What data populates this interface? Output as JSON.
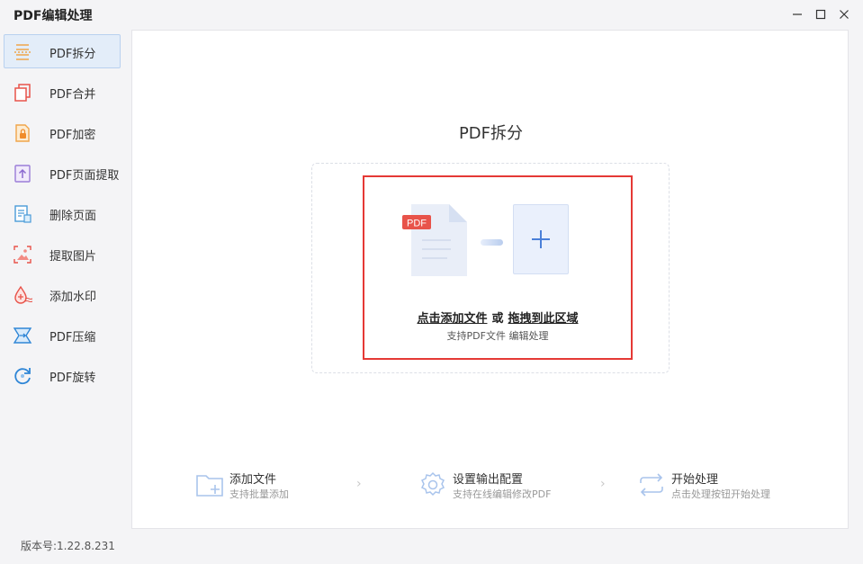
{
  "app": {
    "title": "PDF编辑处理",
    "version": "版本号:1.22.8.231"
  },
  "window_controls": {
    "minimize": "—",
    "maximize": "☐",
    "close": "✕"
  },
  "sidebar": {
    "items": [
      {
        "label": "PDF拆分",
        "icon": "split-icon",
        "active": true
      },
      {
        "label": "PDF合并",
        "icon": "merge-icon"
      },
      {
        "label": "PDF加密",
        "icon": "lock-file-icon"
      },
      {
        "label": "PDF页面提取",
        "icon": "page-extract-icon"
      },
      {
        "label": "删除页面",
        "icon": "delete-page-icon"
      },
      {
        "label": "提取图片",
        "icon": "image-extract-icon"
      },
      {
        "label": "添加水印",
        "icon": "watermark-icon"
      },
      {
        "label": "PDF压缩",
        "icon": "compress-icon"
      },
      {
        "label": "PDF旋转",
        "icon": "rotate-icon"
      }
    ]
  },
  "main": {
    "title": "PDF拆分",
    "dropzone": {
      "badge": "PDF",
      "add_link": "点击添加文件",
      "or": "或",
      "drag_link": "拖拽到此区域",
      "subtitle": "支持PDF文件 编辑处理"
    },
    "steps": [
      {
        "title": "添加文件",
        "subtitle": "支持批量添加",
        "icon": "folder-add-icon"
      },
      {
        "title": "设置输出配置",
        "subtitle": "支持在线编辑修改PDF",
        "icon": "gear-icon"
      },
      {
        "title": "开始处理",
        "subtitle": "点击处理按钮开始处理",
        "icon": "repeat-icon"
      }
    ],
    "step_separator": "›"
  },
  "colors": {
    "accent": "#4a7fd8",
    "active_bg": "#e3edf9",
    "highlight_red": "#e53935",
    "pdf_badge": "#e8534a"
  }
}
